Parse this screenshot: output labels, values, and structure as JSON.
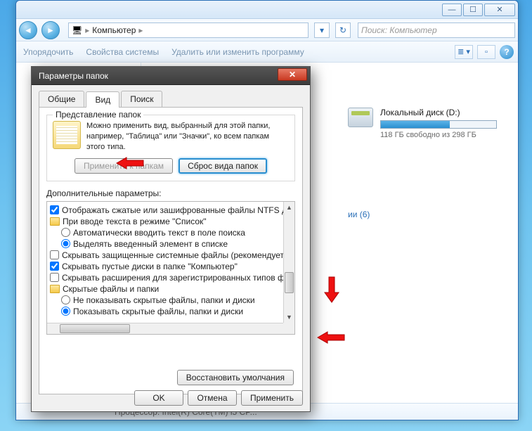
{
  "explorer": {
    "breadcrumb_root": "Компьютер",
    "search_placeholder": "Поиск: Компьютер",
    "toolbar": {
      "organize": "Упорядочить",
      "props": "Свойства системы",
      "uninstall": "Удалить или изменить программу"
    },
    "disk": {
      "name": "Локальный диск (D:)",
      "free_text": "118 ГБ свободно из 298 ГБ",
      "fill_pct": 60
    },
    "category_suffix": "ии (6)",
    "status": "Процессор: Intel(R) Core(TM) i5 CP..."
  },
  "dialog": {
    "title": "Параметры папок",
    "tabs": {
      "general": "Общие",
      "view": "Вид",
      "search": "Поиск"
    },
    "group": {
      "label": "Представление папок",
      "text": "Можно применить вид, выбранный для этой папки, например, \"Таблица\" или \"Значки\", ко всем папкам этого типа.",
      "apply_btn": "Применить к папкам",
      "reset_btn": "Сброс вида папок"
    },
    "params_label": "Дополнительные параметры:",
    "items": [
      {
        "type": "checkbox",
        "checked": true,
        "indent": 0,
        "text": "Отображать сжатые или зашифрованные файлы NTFS другим цветом"
      },
      {
        "type": "folder",
        "indent": 0,
        "text": "При вводе текста в режиме \"Список\""
      },
      {
        "type": "radio",
        "checked": false,
        "indent": 1,
        "text": "Автоматически вводить текст в поле поиска"
      },
      {
        "type": "radio",
        "checked": true,
        "indent": 1,
        "text": "Выделять введенный элемент в списке"
      },
      {
        "type": "checkbox",
        "checked": false,
        "indent": 0,
        "text": "Скрывать защищенные системные файлы (рекомендуется)"
      },
      {
        "type": "checkbox",
        "checked": true,
        "indent": 0,
        "text": "Скрывать пустые диски в папке \"Компьютер\""
      },
      {
        "type": "checkbox",
        "checked": false,
        "indent": 0,
        "text": "Скрывать расширения для зарегистрированных типов файлов"
      },
      {
        "type": "folder",
        "indent": 0,
        "text": "Скрытые файлы и папки"
      },
      {
        "type": "radio",
        "checked": false,
        "indent": 1,
        "text": "Не показывать скрытые файлы, папки и диски"
      },
      {
        "type": "radio",
        "checked": true,
        "indent": 1,
        "text": "Показывать скрытые файлы, папки и диски"
      }
    ],
    "restore_btn": "Восстановить умолчания",
    "footer": {
      "ok": "OK",
      "cancel": "Отмена",
      "apply": "Применить"
    }
  }
}
